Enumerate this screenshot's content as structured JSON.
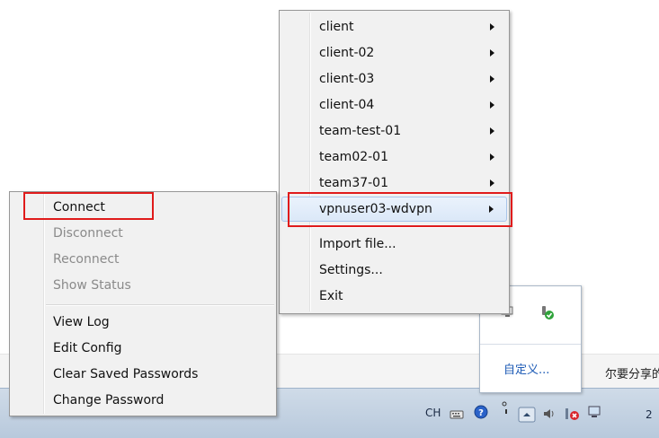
{
  "submenu": {
    "items": [
      {
        "label": "client",
        "arrow": true
      },
      {
        "label": "client-02",
        "arrow": true
      },
      {
        "label": "client-03",
        "arrow": true
      },
      {
        "label": "client-04",
        "arrow": true
      },
      {
        "label": "team-test-01",
        "arrow": true
      },
      {
        "label": "team02-01",
        "arrow": true
      },
      {
        "label": "team37-01",
        "arrow": true
      },
      {
        "label": "vpnuser03-wdvpn",
        "arrow": true,
        "highlighted": true
      }
    ],
    "actions": [
      {
        "label": "Import file..."
      },
      {
        "label": "Settings..."
      },
      {
        "label": "Exit"
      }
    ]
  },
  "context_menu": {
    "group1": [
      {
        "label": "Connect",
        "enabled": true
      },
      {
        "label": "Disconnect",
        "enabled": false
      },
      {
        "label": "Reconnect",
        "enabled": false
      },
      {
        "label": "Show Status",
        "enabled": false
      }
    ],
    "group2": [
      {
        "label": "View Log"
      },
      {
        "label": "Edit Config"
      },
      {
        "label": "Clear Saved Passwords"
      },
      {
        "label": "Change Password"
      }
    ]
  },
  "tray_popup": {
    "customize_link": "自定义..."
  },
  "background": {
    "partial_text": "尔要分享的数"
  },
  "taskbar": {
    "language": "CH",
    "clock_partial": "2"
  },
  "colors": {
    "annotation_red": "#e01b1b",
    "highlight": "#dbe8f8",
    "menu_bg": "#f1f1f1"
  }
}
